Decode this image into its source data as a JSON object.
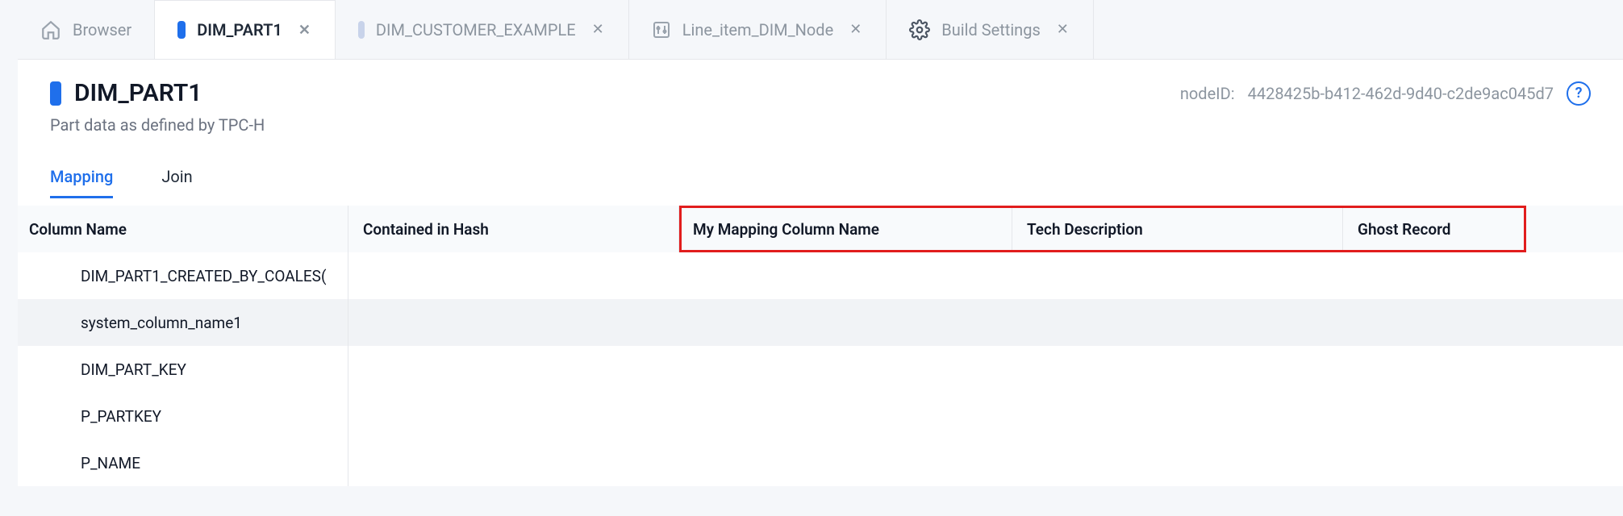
{
  "tabs": {
    "browser": "Browser",
    "dim_part1": "DIM_PART1",
    "dim_customer_example": "DIM_CUSTOMER_EXAMPLE",
    "line_item": "Line_item_DIM_Node",
    "build_settings": "Build Settings",
    "close": "✕"
  },
  "header": {
    "title": "DIM_PART1",
    "subtitle": "Part data as defined by TPC-H",
    "nodeid_label": "nodeID:",
    "nodeid_value": "4428425b-b412-462d-9d40-c2de9ac045d7",
    "help": "?"
  },
  "subnav": {
    "mapping": "Mapping",
    "join": "Join"
  },
  "table": {
    "headers": {
      "col_name": "Column Name",
      "contained": "Contained in Hash",
      "my_mapping": "My Mapping Column Name",
      "tech_desc": "Tech Description",
      "ghost": "Ghost Record"
    },
    "rows": [
      {
        "name": "DIM_PART1_CREATED_BY_COALES("
      },
      {
        "name": "system_column_name1"
      },
      {
        "name": "DIM_PART_KEY"
      },
      {
        "name": "P_PARTKEY"
      },
      {
        "name": "P_NAME"
      }
    ]
  }
}
